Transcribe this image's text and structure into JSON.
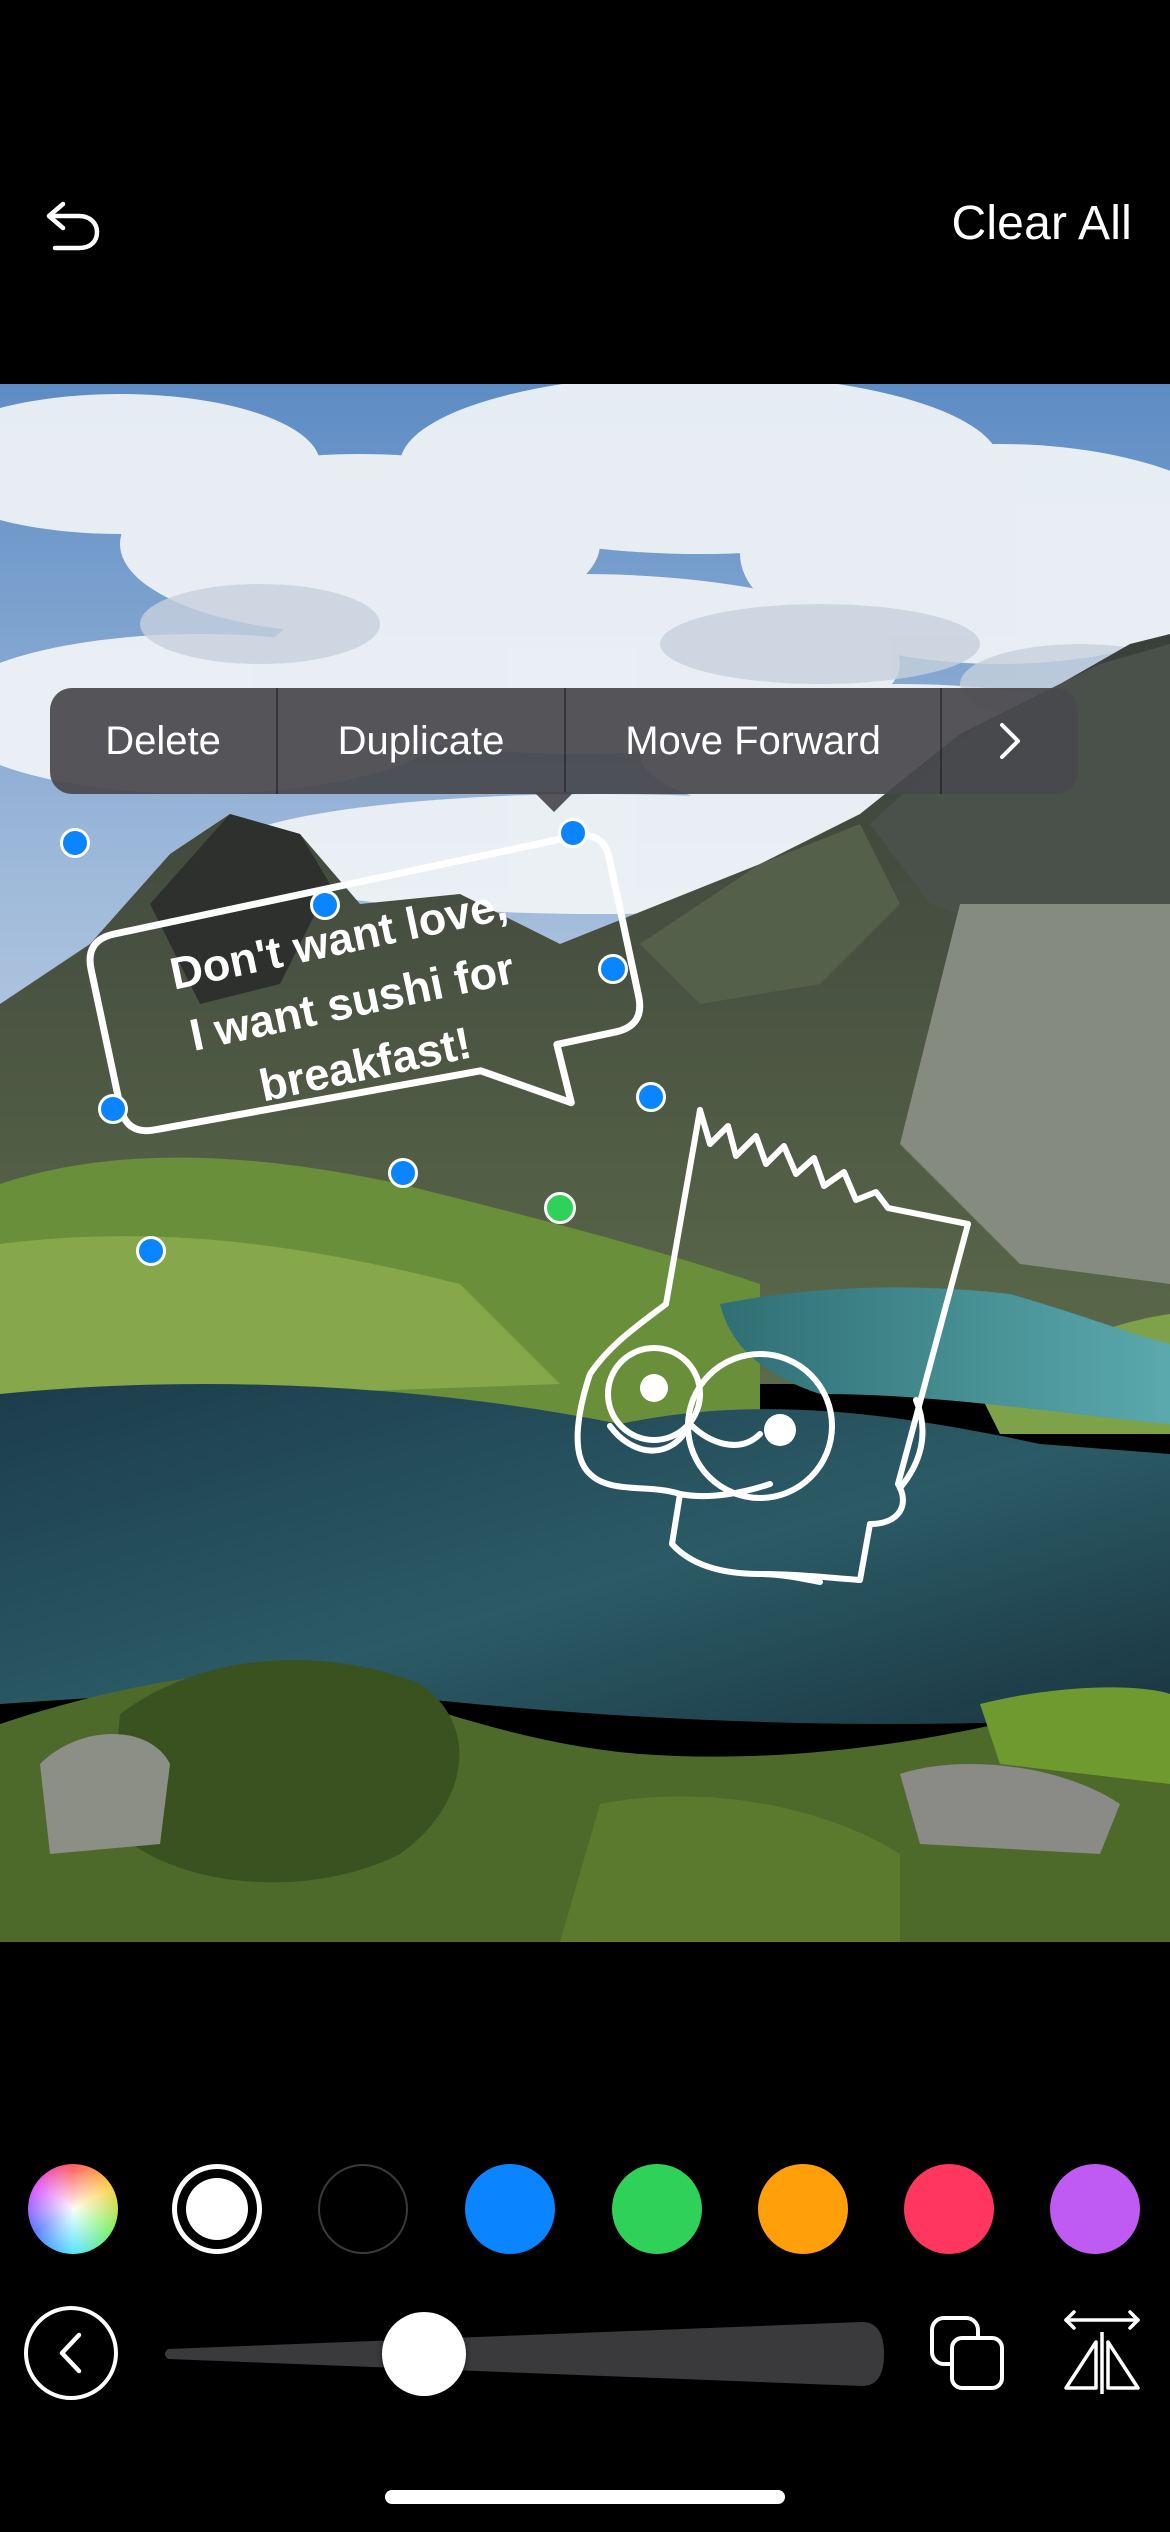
{
  "header": {
    "clear_all_label": "Clear All",
    "undo_icon": "undo-arrow-icon"
  },
  "context_menu": {
    "items": [
      "Delete",
      "Duplicate",
      "Move Forward"
    ],
    "more_icon": "chevron-right-icon"
  },
  "speech_bubble": {
    "lines": [
      "Don't want love,",
      "I want sushi for",
      "breakfast!"
    ]
  },
  "palette": {
    "colors": [
      "rainbow",
      "#FFFFFF",
      "#000000",
      "#0A84FF",
      "#30D158",
      "#FF9F0A",
      "#FF375F",
      "#BF5AF2"
    ],
    "selected_index": 1
  },
  "toolbar": {
    "back_icon": "chevron-left-icon",
    "slider_value": 0.33,
    "shape_icon": "overlapping-squares-icon",
    "flip_icon": "flip-horizontal-icon"
  }
}
